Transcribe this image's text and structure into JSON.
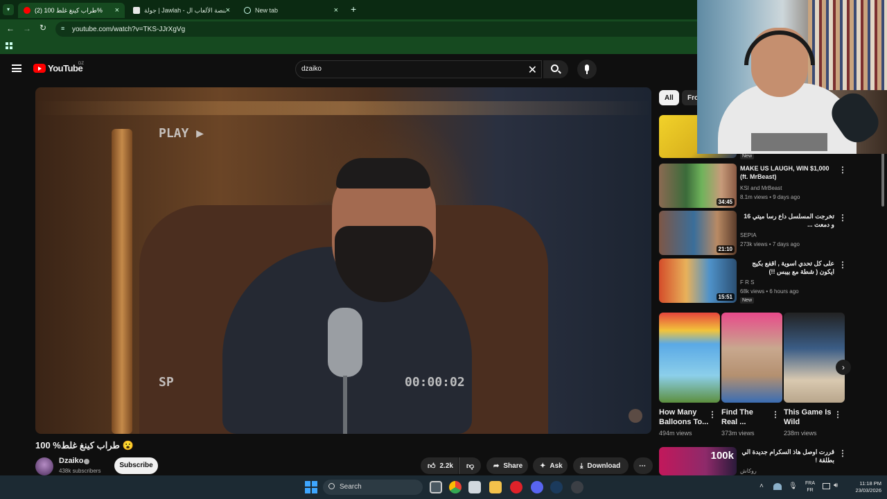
{
  "browser": {
    "tabs": [
      {
        "label": "(2) طراب كينغ غلط 100%"
      },
      {
        "label": "جولة | Jawlah - منصة الألعاب ال..."
      },
      {
        "label": "New tab"
      }
    ],
    "url": "youtube.com/watch?v=TKS-JJrXgVg"
  },
  "youtube": {
    "logo_text": "YouTube",
    "country": "DZ",
    "search_value": "dzaiko",
    "video": {
      "overlay_play": "PLAY ▶",
      "overlay_sp": "SP",
      "overlay_time": "00:00:02",
      "title": "100 %طراب كينغ غلط 😮",
      "channel": "Dzaiko",
      "subscribers": "438k subscribers",
      "subscribe_label": "Subscribe",
      "likes": "2.2k",
      "share_label": "Share",
      "ask_label": "Ask",
      "download_label": "Download"
    },
    "chips": [
      {
        "label": "All"
      },
      {
        "label": "From"
      }
    ],
    "recommended": [
      {
        "title": "",
        "badge": "New",
        "channel": "",
        "meta": ""
      },
      {
        "title": "MAKE US LAUGH, WIN $1,000 (ft. MrBeast)",
        "channel": "KSI and MrBeast",
        "meta": "8.1m views • 9 days ago",
        "duration": "34:45"
      },
      {
        "title": "تخرجت المسلسل داع رسا ميتي 16 و دمعت ...",
        "channel": "SEPIA",
        "meta": "273k views • 7 days ago",
        "duration": "21:10"
      },
      {
        "title": "على كل تحدي اسوية , اقفع بكيج ايكون ( شطة مع بيبس !!)",
        "channel": "F R S",
        "meta": "68k views • 6 hours ago",
        "duration": "15:51",
        "badge": "New"
      }
    ],
    "shorts": [
      {
        "title": "How Many Balloons To...",
        "views": "494m views"
      },
      {
        "title": "Find The Real ...",
        "views": "373m views"
      },
      {
        "title": "This Game Is Wild",
        "views": "238m views"
      }
    ],
    "bottom_item": {
      "title": "قررت اوصل هاذ السكرام جديدة الي بطلقة !",
      "thumb_text": "100k",
      "channel": "روكاش"
    }
  },
  "taskbar": {
    "search_placeholder": "Search",
    "lang_top": "FRA",
    "lang_bottom": "FR",
    "time": "11:18 PM",
    "date": "23/03/2026"
  },
  "colors": {
    "browser_bg": "#164a20",
    "tabbar_bg": "#0b2a12",
    "yt_bg": "#0f0f0f",
    "yt_red": "#ff0000"
  }
}
